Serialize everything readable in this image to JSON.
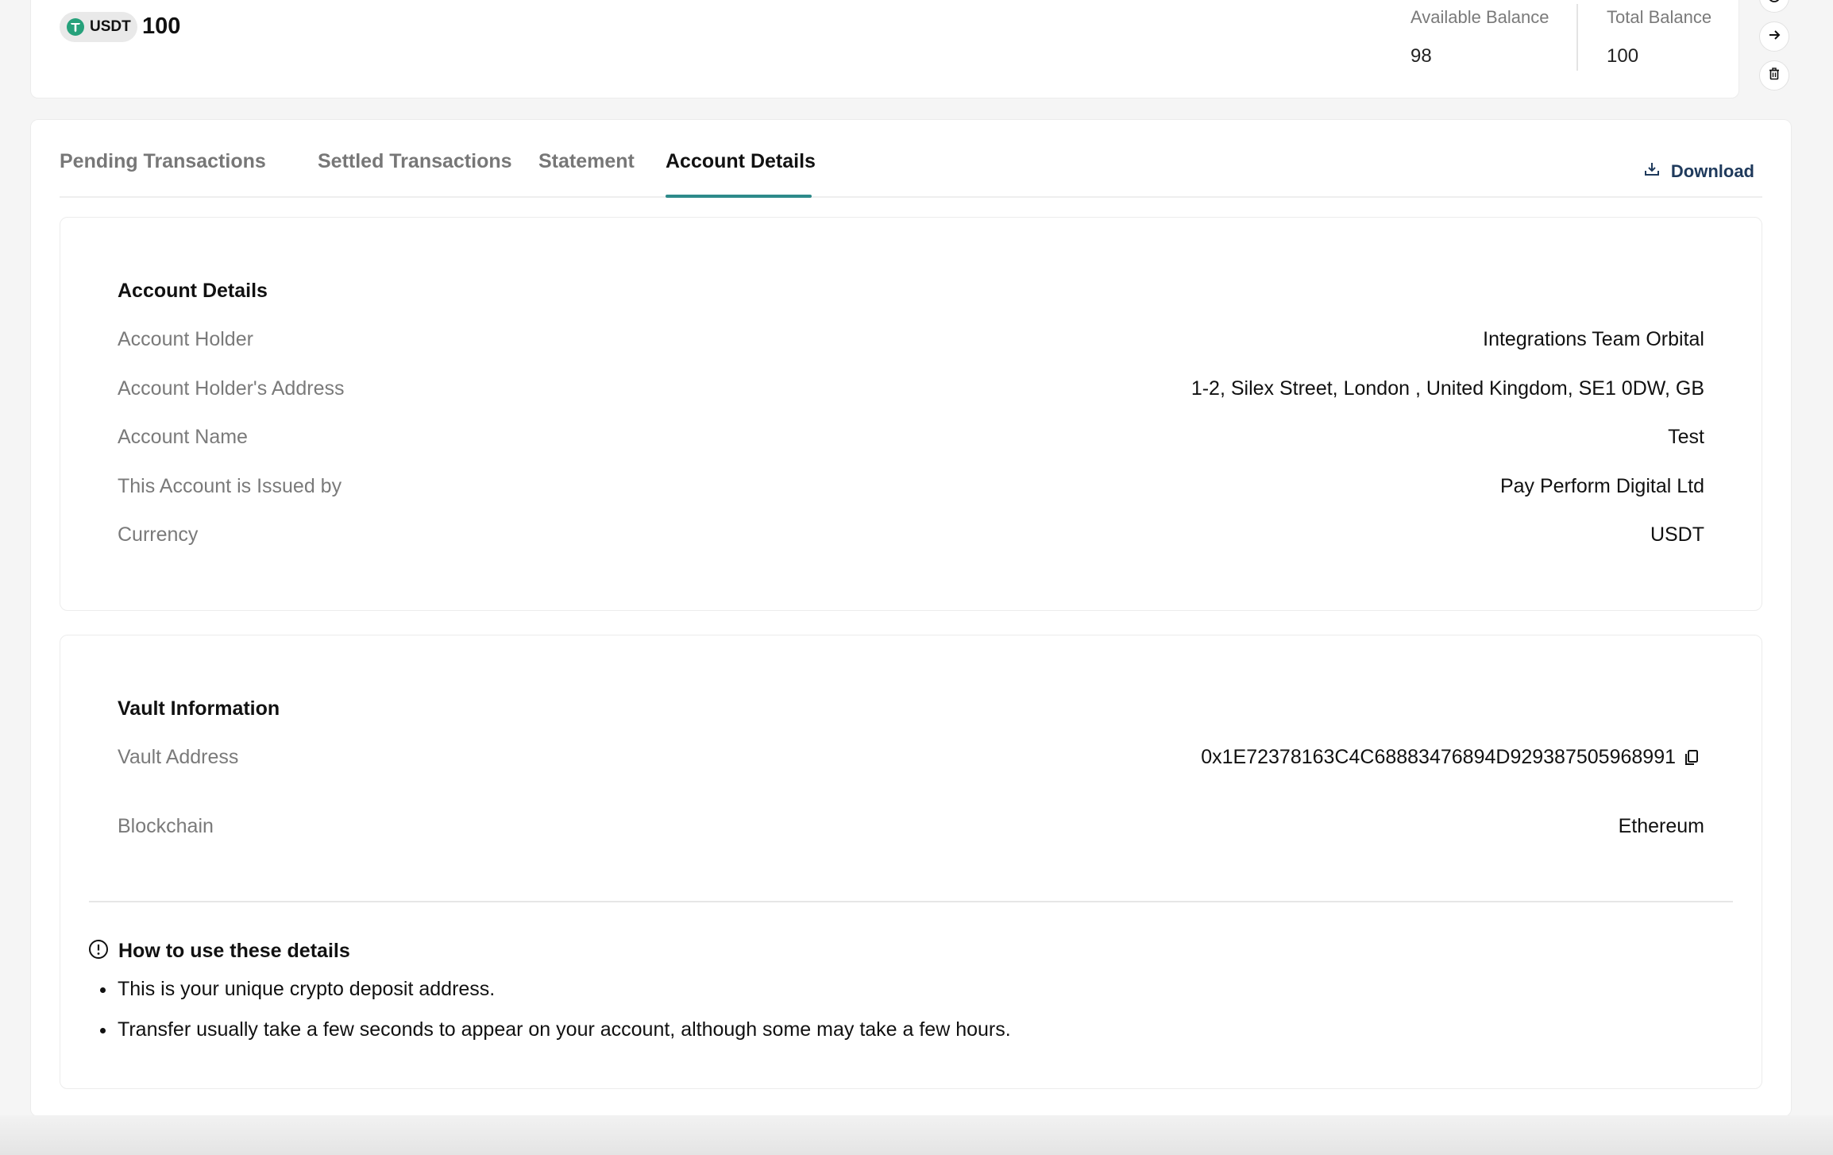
{
  "account_card": {
    "currency_code": "USDT",
    "amount": "100",
    "available_label": "Available Balance",
    "available_value": "98",
    "total_label": "Total Balance",
    "total_value": "100",
    "currency_icon": "tether-icon"
  },
  "side_actions": [
    {
      "icon": "info-icon"
    },
    {
      "icon": "arrow-right-icon"
    },
    {
      "icon": "trash-icon"
    }
  ],
  "tabs": [
    {
      "label": "Pending Transactions"
    },
    {
      "label": "Settled Transactions"
    },
    {
      "label": "Statement"
    },
    {
      "label": "Account Details",
      "active": true
    }
  ],
  "download_label": "Download",
  "account_details": {
    "title": "Account Details",
    "rows": [
      {
        "label": "Account Holder",
        "value": "Integrations Team Orbital"
      },
      {
        "label": "Account Holder's Address",
        "value": "1-2, Silex Street, London , United Kingdom, SE1 0DW, GB"
      },
      {
        "label": "Account Name",
        "value": "Test"
      },
      {
        "label": "This Account is Issued by",
        "value": "Pay Perform Digital Ltd"
      },
      {
        "label": "Currency",
        "value": "USDT"
      }
    ]
  },
  "vault": {
    "title": "Vault Information",
    "address_label": "Vault Address",
    "address_value": "0x1E72378163C4C68883476894D929387505968991",
    "blockchain_label": "Blockchain",
    "blockchain_value": "Ethereum"
  },
  "howto": {
    "title": "How to use these details",
    "items": [
      "This is your unique crypto deposit address.",
      "Transfer usually take a few seconds to appear on your account, although some may take a few hours."
    ]
  },
  "colors": {
    "accent": "#2d8a8a",
    "download": "#1f3a5c",
    "tether": "#26a17b"
  }
}
